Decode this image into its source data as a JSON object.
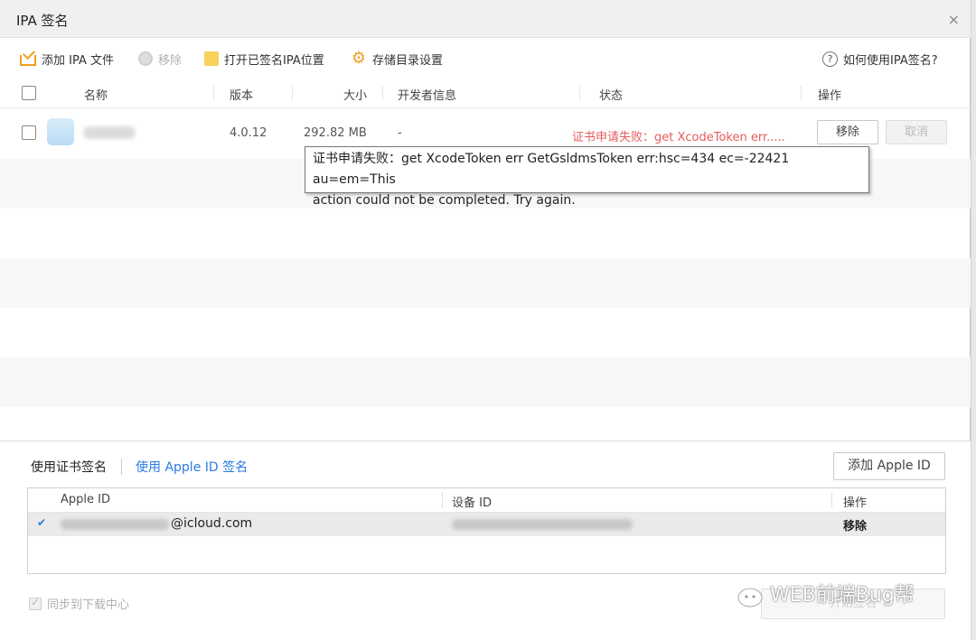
{
  "window": {
    "title": "IPA 签名",
    "close_glyph": "×"
  },
  "toolbar": {
    "add_ipa": "添加 IPA 文件",
    "remove": "移除",
    "open_signed": "打开已签名IPA位置",
    "storage_settings": "存储目录设置",
    "help": "如何使用IPA签名?"
  },
  "table": {
    "headers": {
      "name": "名称",
      "version": "版本",
      "size": "大小",
      "developer": "开发者信息",
      "status": "状态",
      "actions": "操作"
    },
    "rows": [
      {
        "version": "4.0.12",
        "size": "292.82 MB",
        "developer": "-",
        "status": "证书申请失败：get XcodeToken err.....",
        "remove_label": "移除",
        "cancel_label": "取消"
      }
    ]
  },
  "tooltip": {
    "line1": "证书申请失败：get XcodeToken err GetGsldmsToken err:hsc=434 ec=-22421 au=em=This",
    "line2": "action could not be completed. Try again."
  },
  "signing": {
    "tab_cert": "使用证书签名",
    "tab_apple_id": "使用 Apple ID 签名",
    "add_apple_id": "添加 Apple ID",
    "headers": {
      "apple_id": "Apple ID",
      "device_id": "设备 ID",
      "actions": "操作"
    },
    "rows": [
      {
        "check": "✔",
        "apple_id_suffix": "@icloud.com",
        "action": "移除"
      }
    ],
    "sync_label": "同步到下载中心",
    "start_label": "开始签名"
  },
  "watermark": {
    "text": "WEB前端Bug帮"
  },
  "colors": {
    "error": "#e65c5c",
    "link": "#2a7ae2",
    "accent_icon": "#f0a020"
  }
}
